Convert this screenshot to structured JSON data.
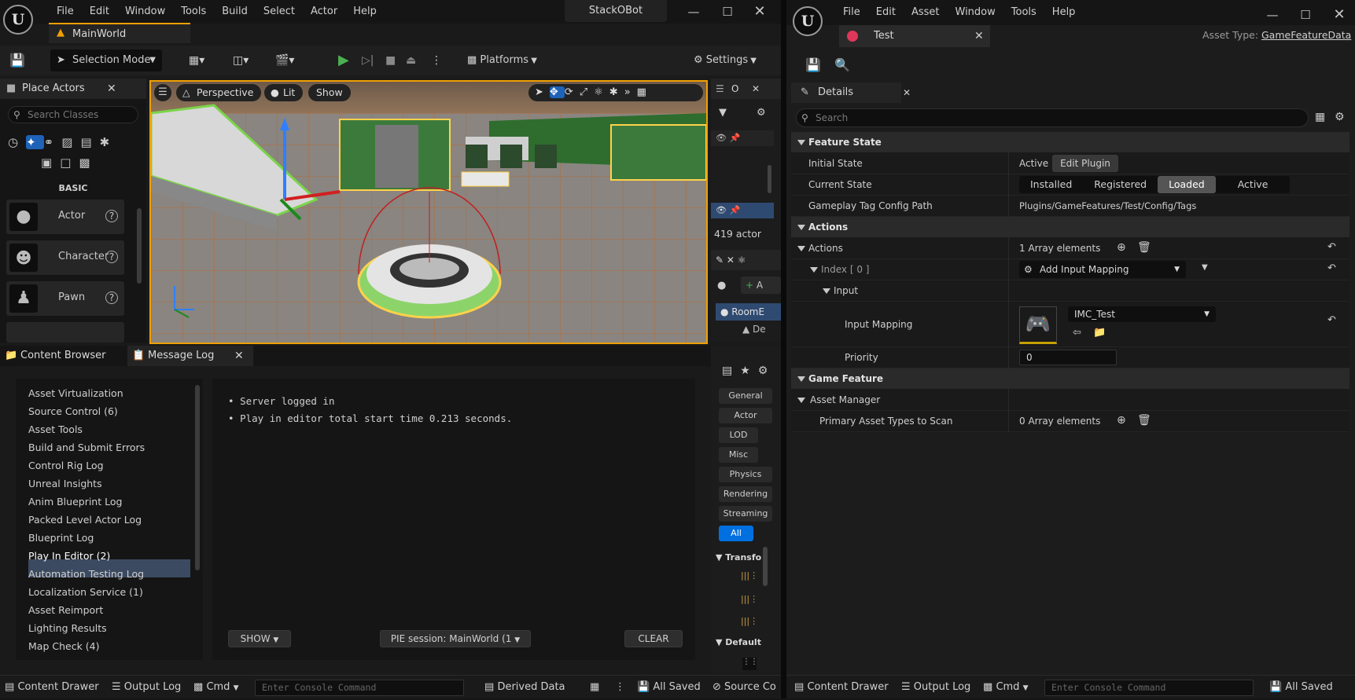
{
  "left": {
    "menu": [
      "File",
      "Edit",
      "Window",
      "Tools",
      "Build",
      "Select",
      "Actor",
      "Help"
    ],
    "project": "StackOBot",
    "level_tab": "MainWorld",
    "toolbar": {
      "mode": "Selection Mode",
      "platforms": "Platforms",
      "settings": "Settings"
    },
    "viewport": {
      "perspective": "Perspective",
      "lit": "Lit",
      "show": "Show"
    },
    "place_actors": {
      "title": "Place Actors",
      "search_placeholder": "Search Classes",
      "section": "BASIC",
      "items": [
        "Actor",
        "Character",
        "Pawn"
      ]
    },
    "outliner": {
      "title": "O",
      "actor_count": "419 actor",
      "add": "A",
      "row1": "RoomE",
      "row2": "De"
    },
    "bottom_tabs": {
      "content_browser": "Content Browser",
      "message_log": "Message Log"
    },
    "log_categories": [
      "Asset Virtualization",
      "Source Control (6)",
      "Asset Tools",
      "Build and Submit Errors",
      "Control Rig Log",
      "Unreal Insights",
      "Anim Blueprint Log",
      "Packed Level Actor Log",
      "Blueprint Log",
      "Play In Editor (2)",
      "Automation Testing Log",
      "Localization Service (1)",
      "Asset Reimport",
      "Lighting Results",
      "Map Check (4)"
    ],
    "selected_category": "Play In Editor (2)",
    "log_messages": [
      "Server logged in",
      "Play in editor total start time 0.213 seconds."
    ],
    "log_footer": {
      "show": "SHOW",
      "session": "PIE session: MainWorld (1",
      "clear": "CLEAR"
    },
    "detail_filters": [
      "General",
      "Actor",
      "LOD",
      "Misc",
      "Physics",
      "Rendering",
      "Streaming",
      "All"
    ],
    "detail_sections": {
      "transform": "Transfo",
      "default": "Default"
    },
    "statusbar": {
      "content_drawer": "Content Drawer",
      "output_log": "Output Log",
      "cmd": "Cmd",
      "console_placeholder": "Enter Console Command",
      "derived_data": "Derived Data",
      "all_saved": "All Saved",
      "source_control": "Source Co"
    }
  },
  "right": {
    "menu": [
      "File",
      "Edit",
      "Asset",
      "Window",
      "Tools",
      "Help"
    ],
    "tab": "Test",
    "asset_type_label": "Asset Type:",
    "asset_type": "GameFeatureData",
    "details_title": "Details",
    "search_placeholder": "Search",
    "feature_state": {
      "section": "Feature State",
      "initial_state_label": "Initial State",
      "initial_state_value": "Active",
      "edit_plugin": "Edit Plugin",
      "current_state_label": "Current State",
      "states": [
        "Installed",
        "Registered",
        "Loaded",
        "Active"
      ],
      "selected_state": "Loaded",
      "tag_path_label": "Gameplay Tag Config Path",
      "tag_path_value": "Plugins/GameFeatures/Test/Config/Tags"
    },
    "actions": {
      "section": "Actions",
      "actions_label": "Actions",
      "actions_value": "1 Array elements",
      "index_label": "Index [ 0 ]",
      "index_value": "Add Input Mapping",
      "input_label": "Input",
      "input_mapping_label": "Input Mapping",
      "input_mapping_value": "IMC_Test",
      "priority_label": "Priority",
      "priority_value": "0"
    },
    "game_feature": {
      "section": "Game Feature",
      "asset_manager": "Asset Manager",
      "primary_label": "Primary Asset Types to Scan",
      "primary_value": "0 Array elements"
    },
    "statusbar": {
      "content_drawer": "Content Drawer",
      "output_log": "Output Log",
      "cmd": "Cmd",
      "console_placeholder": "Enter Console Command",
      "all_saved": "All Saved"
    }
  },
  "colors": {
    "accent_blue": "#0070e0",
    "selection": "#3b4a60",
    "play_green": "#4caf50"
  }
}
